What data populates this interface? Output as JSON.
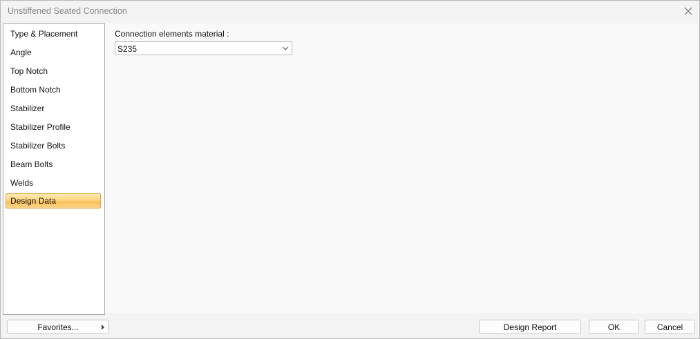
{
  "window": {
    "title": "Unstiffened Seated Connection",
    "close_icon": "close-icon"
  },
  "sidebar": {
    "items": [
      {
        "label": "Type & Placement"
      },
      {
        "label": "Angle"
      },
      {
        "label": "Top Notch"
      },
      {
        "label": "Bottom Notch"
      },
      {
        "label": "Stabilizer"
      },
      {
        "label": "Stabilizer Profile"
      },
      {
        "label": "Stabilizer Bolts"
      },
      {
        "label": "Beam Bolts"
      },
      {
        "label": "Welds"
      },
      {
        "label": "Design Data"
      }
    ],
    "selected": "Design Data"
  },
  "main": {
    "material_label": "Connection elements material :",
    "material_value": "S235",
    "dropdown_icon": "chevron-down-icon"
  },
  "footer": {
    "favorites_label": "Favorites...",
    "favorites_icon": "chevron-right-icon",
    "design_report_label": "Design Report",
    "ok_label": "OK",
    "cancel_label": "Cancel"
  },
  "colors": {
    "selection_fill": "#fcc15a",
    "selection_border": "#d9a546"
  }
}
